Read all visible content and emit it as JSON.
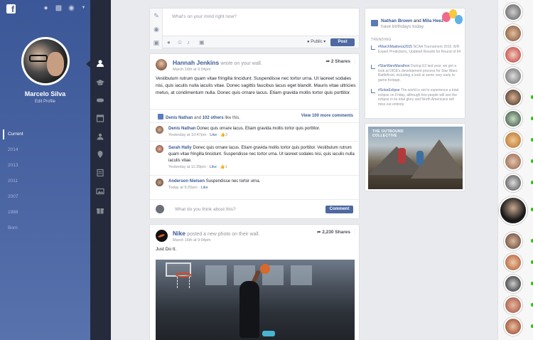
{
  "colors": {
    "brand_blue": "#3b5998",
    "button_blue": "#4e69a2",
    "online_green": "#42b72a",
    "sidebar_dark": "#252b3d"
  },
  "profile": {
    "name": "Marcelo Silva",
    "edit_label": "Edit Profile"
  },
  "timeline": [
    "Current",
    "2014",
    "2013",
    "2011",
    "2007",
    "1988",
    "Born"
  ],
  "composer": {
    "placeholder": "What's on your mind right now?",
    "privacy": "Public",
    "post_label": "Post"
  },
  "post1": {
    "author": "Hannah Jenkins",
    "action": "wrote on your wall.",
    "time": "March 16th at 9:04pm",
    "shares": "2 Shares",
    "text": "Vestibulum rutrum quam vitae fringilla tincidunt. Suspendisse nec tortor urna. Ut laoreet sodales nisi, quis iaculis nulla iaculis vitae. Donec sagittis faucibus lacus eget blandit. Mauris vitae ultricies metus, at condimentum nulla. Donec quis ornare lacus. Etiam gravida mollis tortor quis porttitor.",
    "likes_name": "Denis Nathan",
    "likes_and": "and",
    "likes_others": "102 others",
    "likes_suffix": "like this.",
    "view_more": "View 100 more comments",
    "comments": [
      {
        "name": "Denis Nathan",
        "text": "Donec quis ornare lacus. Etiam gravida mollis tortor quis porttitor.",
        "time": "Yesterday at 10:47pm",
        "like": "Like",
        "count": "3"
      },
      {
        "name": "Sarah Hally",
        "text": "Donec quis ornare lacus. Etiam gravida mollis tortor quis porttitor. Vestibulum rutrum quam vitae fringilla tincidunt. Suspendisse nec tortor urna. Ut laoreet sodales nisi, quis iaculis nulla iaculis vitae.",
        "time": "Yesterday at 11:39pm",
        "like": "Like",
        "count": "1"
      },
      {
        "name": "Anderson Nielsen",
        "text": "Suspendisse nec tortor urna.",
        "time": "Today at 9:20am",
        "like": "Like",
        "count": ""
      }
    ],
    "write_placeholder": "What do you think about this?",
    "comment_label": "Comment"
  },
  "post2": {
    "author": "Nike",
    "action": "posted a new photo on their wall.",
    "time": "March 16th at 9:04pm",
    "shares": "2,230 Shares",
    "text": "Just Do It."
  },
  "birthdays": {
    "name1": "Nathan Brown",
    "and": "and",
    "name2": "Mila Heez",
    "suffix": "have birthdays today."
  },
  "trending": {
    "title": "TRENDING",
    "items": [
      {
        "tag": "#MarchMadness2015",
        "text": "NCAA Tournament 2015: B/R Expert Predictions, Updated Results for Round of 64"
      },
      {
        "tag": "#StarWarsMarathon",
        "text": "During E3 last year, we got a look at DICE's development process for Star Wars: Battlefront, including a look at some very early in-game footage."
      },
      {
        "tag": "#SolarEclipse",
        "text": "The world is set to experience a total eclipse on Friday, although few people will see the eclipse in its total glory and North Americans will miss out entirely."
      }
    ]
  },
  "ad": {
    "brand_line1": "THE OUTBOUND",
    "brand_line2": "COLLECTIVE"
  },
  "icons": [
    "facebook-logo",
    "friends-icon",
    "messages-icon",
    "globe-icon",
    "pencil-icon",
    "mic-icon",
    "camera-icon",
    "location-icon",
    "smiley-icon",
    "music-icon",
    "photo-icon",
    "share-icon",
    "like-icon"
  ]
}
